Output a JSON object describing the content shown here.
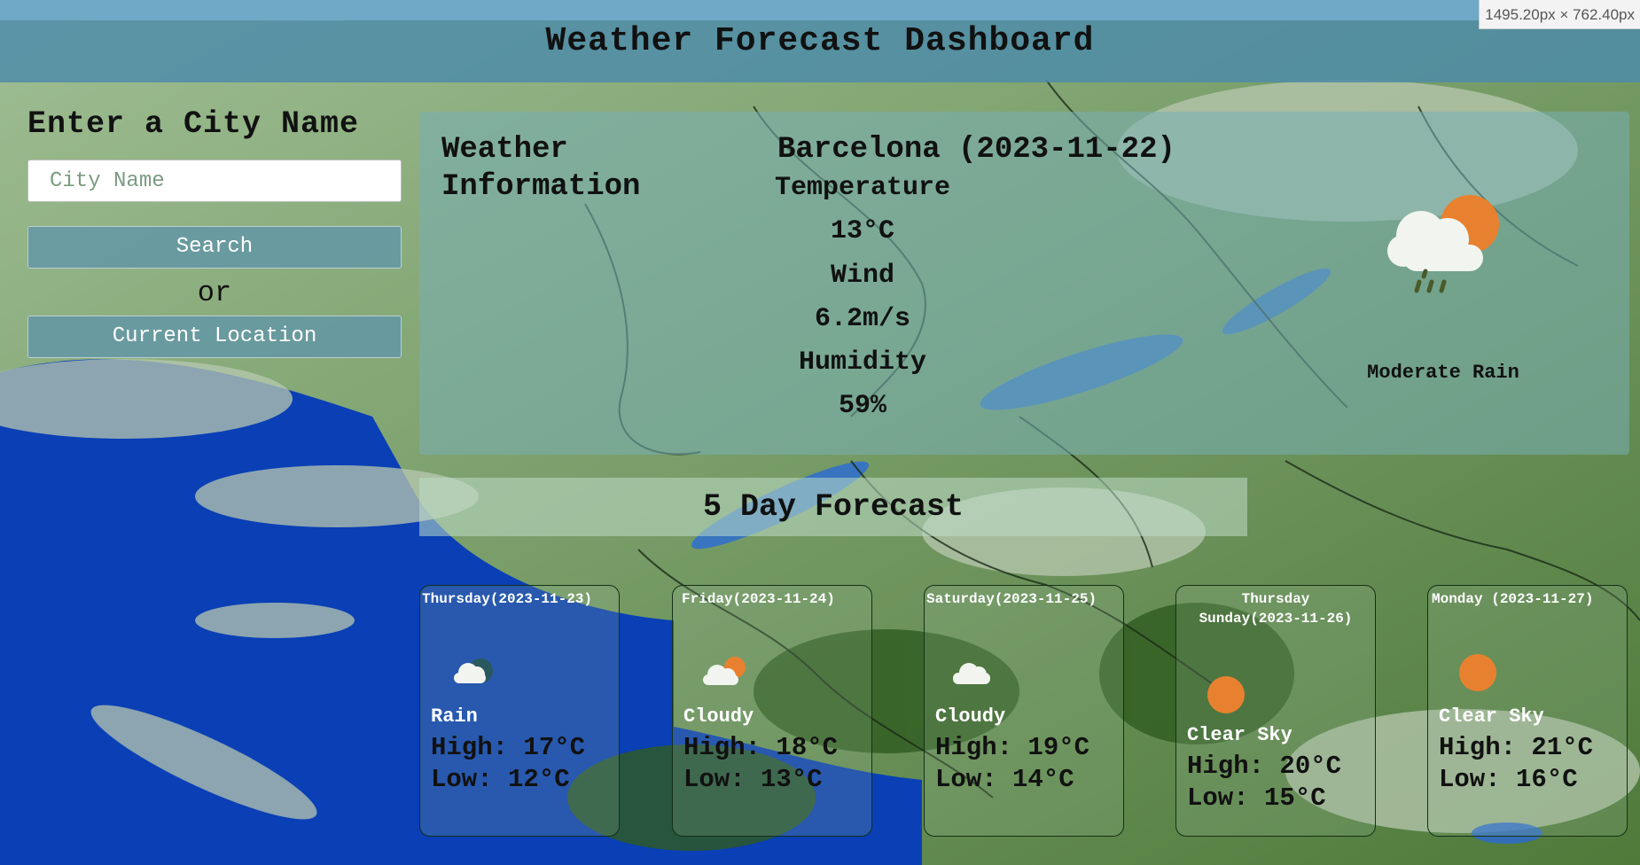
{
  "devtools": {
    "size_readout": "1495.20px × 762.40px"
  },
  "header": {
    "title": "Weather Forecast Dashboard"
  },
  "sidebar": {
    "heading": "Enter a City Name",
    "city_input": {
      "placeholder": "City Name",
      "value": ""
    },
    "search_label": "Search",
    "or_label": "or",
    "current_location_label": "Current Location"
  },
  "current": {
    "section_title": "Weather Information",
    "city_date": "Barcelona (2023-11-22)",
    "temperature_label": "Temperature",
    "temperature": "13°C",
    "wind_label": "Wind",
    "wind": "6.2m/s",
    "humidity_label": "Humidity",
    "humidity": "59%",
    "description": "Moderate Rain",
    "icon": "cloud-sun-rain-icon"
  },
  "forecast": {
    "title": "5 Day Forecast",
    "days": [
      {
        "day": "Thursday(2023-11-23)",
        "icon": "cloud-rain-icon",
        "desc": "Rain",
        "high": "High: 17°C",
        "low": "Low: 12°C"
      },
      {
        "day": "Friday(2023-11-24)",
        "icon": "cloud-sun-icon",
        "desc": "Cloudy",
        "high": "High: 18°C",
        "low": "Low: 13°C"
      },
      {
        "day": "Saturday(2023-11-25)",
        "icon": "cloud-icon",
        "desc": "Cloudy",
        "high": "High: 19°C",
        "low": "Low: 14°C"
      },
      {
        "day": "Thursday Sunday(2023-11-26)",
        "icon": "sun-icon",
        "desc": "Clear Sky",
        "high": "High: 20°C",
        "low": "Low: 15°C"
      },
      {
        "day": "Monday (2023-11-27)",
        "icon": "sun-icon",
        "desc": "Clear Sky",
        "high": "High: 21°C",
        "low": "Low: 16°C"
      }
    ]
  },
  "colors": {
    "sun": "#e8812f",
    "cloud": "#f2f5ef",
    "header": "#4e8ca8",
    "ocean": "#0a3fb5",
    "land": "#3d6e2e"
  }
}
